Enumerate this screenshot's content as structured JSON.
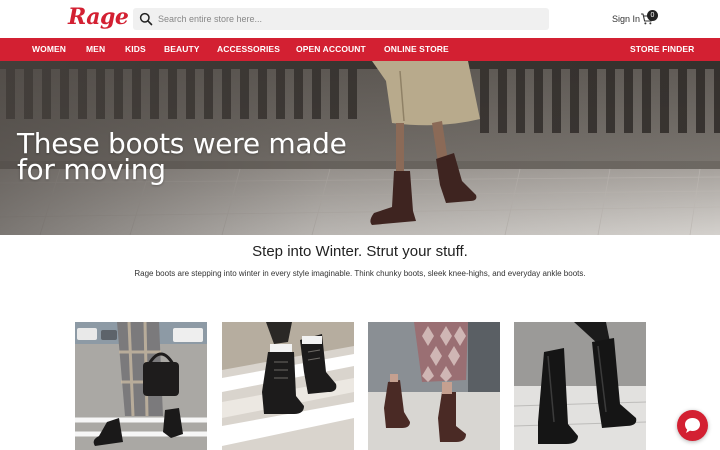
{
  "header": {
    "logo_text": "Rage",
    "search_placeholder": "Search entire store here...",
    "signin_label": "Sign In",
    "cart_count": "0"
  },
  "nav": {
    "items": [
      "WOMEN",
      "MEN",
      "KIDS",
      "BEAUTY",
      "ACCESSORIES",
      "OPEN ACCOUNT",
      "ONLINE STORE"
    ],
    "right_item": "STORE FINDER"
  },
  "hero": {
    "headline_line1": "These boots were made",
    "headline_line2": "for moving"
  },
  "intro": {
    "title": "Step into Winter. Strut your stuff.",
    "body": "Rage boots are stepping into winter in every style imaginable. Think chunky boots, sleek knee-highs, and everyday ankle boots."
  },
  "colors": {
    "brand_red": "#d32032",
    "nav_text": "#ffffff",
    "search_bg": "#f0f0f0"
  },
  "icons": {
    "search": "search-icon",
    "cart": "cart-icon",
    "chat": "chat-icon"
  }
}
